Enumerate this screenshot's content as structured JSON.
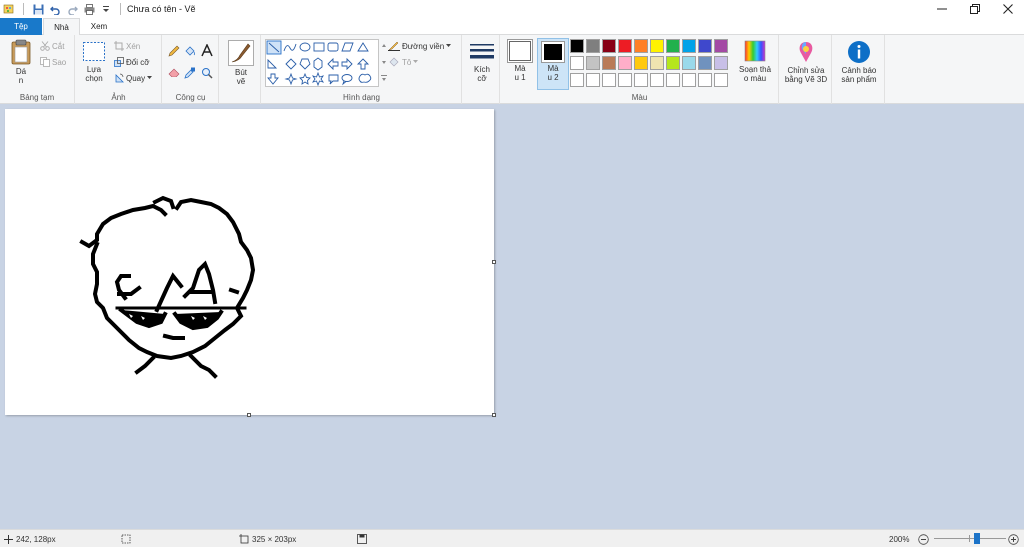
{
  "window": {
    "title": "Chưa có tên - Vẽ"
  },
  "tabs": {
    "file": "Tệp",
    "home": "Nhà",
    "view": "Xem"
  },
  "ribbon": {
    "clipboard": {
      "paste": "Dá\nn",
      "cut": "Cắt",
      "copy": "Sao",
      "group": "Bảng tạm"
    },
    "image": {
      "select": "Lựa\nchọn",
      "crop": "Xén",
      "resize": "Đổi cỡ",
      "rotate": "Quay",
      "group": "Ảnh"
    },
    "tools": {
      "group": "Công cụ"
    },
    "brushes": {
      "label": "Bút\nvẽ"
    },
    "shapes": {
      "outline": "Đường viền",
      "fill": "Tô",
      "group": "Hình dạng"
    },
    "size": {
      "label": "Kích\ncỡ"
    },
    "color1": {
      "label": "Mà\nu 1",
      "value": "#ffffff"
    },
    "color2": {
      "label": "Mà\nu 2",
      "value": "#000000"
    },
    "colors": {
      "group": "Màu",
      "row1": [
        "#000000",
        "#7f7f7f",
        "#880015",
        "#ed1c24",
        "#ff7f27",
        "#fff200",
        "#22b14c",
        "#00a2e8",
        "#3f48cc",
        "#a349a4"
      ],
      "row2": [
        "#ffffff",
        "#c3c3c3",
        "#b97a57",
        "#ffaec9",
        "#ffc90e",
        "#efe4b0",
        "#b5e61d",
        "#99d9ea",
        "#7092be",
        "#c8bfe7"
      ],
      "row3": [
        "#ffffff",
        "#ffffff",
        "#ffffff",
        "#ffffff",
        "#ffffff",
        "#ffffff",
        "#ffffff",
        "#ffffff",
        "#ffffff",
        "#ffffff"
      ]
    },
    "edit_colors": "Soạn thả\no màu",
    "paint3d": "Chỉnh sửa\nbằng Vẽ 3D",
    "product_alert": "Cảnh báo\nsản phẩm"
  },
  "status": {
    "cursor_pos": "242, 128px",
    "image_size": "325 × 203px",
    "zoom": "200%",
    "zoom_level": 0.6
  }
}
